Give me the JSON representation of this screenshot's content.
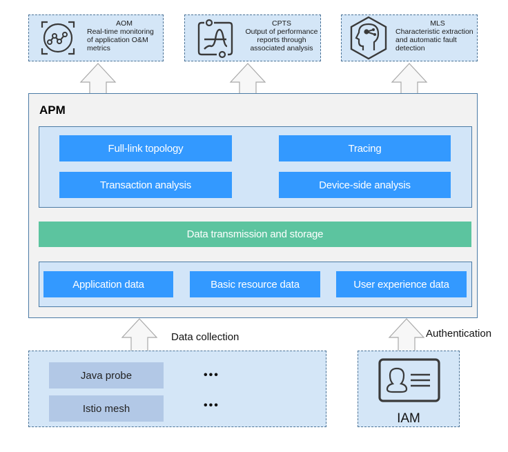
{
  "services": [
    {
      "name": "AOM",
      "icon": "monitoring-chart-icon",
      "description": [
        "Real-time monitoring",
        "of application O&M",
        "metrics"
      ]
    },
    {
      "name": "CPTS",
      "icon": "performance-report-icon",
      "description": [
        "Output of performance",
        "reports through",
        "associated analysis"
      ]
    },
    {
      "name": "MLS",
      "icon": "ai-head-icon",
      "description": [
        "Characteristic extraction",
        "and automatic fault",
        "detection"
      ]
    }
  ],
  "apm": {
    "title": "APM",
    "analysis": [
      "Full-link topology",
      "Tracing",
      "Transaction analysis",
      "Device-side analysis"
    ],
    "transmission": "Data transmission and storage",
    "data_sources": [
      "Application data",
      "Basic resource data",
      "User experience data"
    ]
  },
  "collection": {
    "label": "Data collection",
    "probes": [
      "Java probe",
      "Istio mesh"
    ],
    "ellipsis": [
      "•••",
      "•••"
    ]
  },
  "auth": {
    "label": "Authentication",
    "service": "IAM",
    "icon": "id-card-icon"
  },
  "colors": {
    "service_bg": "#d4e6f7",
    "apm_bg": "#f2f2f2",
    "panel_bg": "#d2e5f8",
    "button_blue": "#3399ff",
    "storage_green": "#5cc49f",
    "probe_bg": "#b2c8e6",
    "border": "#4a7aa5"
  }
}
